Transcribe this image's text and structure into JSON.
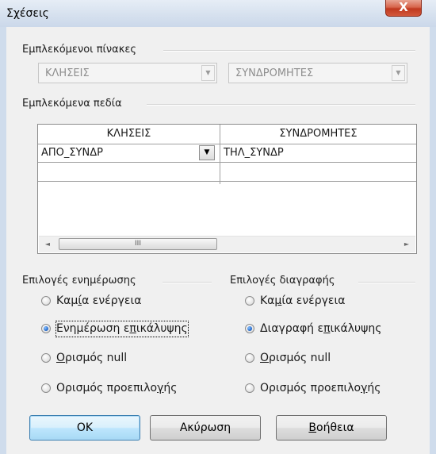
{
  "window": {
    "title": "Σχέσεις",
    "close_glyph": "X"
  },
  "tables_group": {
    "label": "Εμπλεκόμενοι πίνακες",
    "left_combo": "ΚΛΗΣΕΙΣ",
    "right_combo": "ΣΥΝΔΡΟΜΗΤΕΣ",
    "arrow_glyph": "▼"
  },
  "fields_group": {
    "label": "Εμπλεκόμενα πεδία",
    "columns": [
      "ΚΛΗΣΕΙΣ",
      "ΣΥΝΔΡΟΜΗΤΕΣ"
    ],
    "rows": [
      [
        "ΑΠΟ_ΣΥΝΔΡ",
        "ΤΗΛ_ΣΥΝΔΡ"
      ],
      [
        "",
        ""
      ]
    ],
    "scroll_left_glyph": "◄",
    "scroll_right_glyph": "►",
    "scroll_thumb_glyph": "III",
    "dropdown_glyph": "▼"
  },
  "update_options": {
    "label": "Επιλογές ενημέρωσης",
    "options": [
      {
        "pre": "Καμ",
        "u": "ί",
        "post": "α ενέργεια",
        "selected": false
      },
      {
        "pre": "Ενημέρωση ε",
        "u": "π",
        "post": "ικάλυψης",
        "selected": true
      },
      {
        "pre": "",
        "u": "Ο",
        "post": "ρισμός null",
        "selected": false
      },
      {
        "pre": "Ορισμός προεπιλο",
        "u": "γ",
        "post": "ής",
        "selected": false
      }
    ]
  },
  "delete_options": {
    "label": "Επιλογές διαγραφής",
    "options": [
      {
        "pre": "Κα",
        "u": "μ",
        "post": "ία ενέργεια",
        "selected": false
      },
      {
        "pre": "Διαγραφή ε",
        "u": "π",
        "post": "ικάλυψης",
        "selected": true
      },
      {
        "pre": "",
        "u": "Ο",
        "post": "ρισμός null",
        "selected": false
      },
      {
        "pre": "Ορισμός προεπιλο",
        "u": "γ",
        "post": "ής",
        "selected": false
      }
    ]
  },
  "buttons": {
    "ok": "OK",
    "cancel": "Ακύρωση",
    "help_u": "Β",
    "help_rest": "οήθεια"
  }
}
